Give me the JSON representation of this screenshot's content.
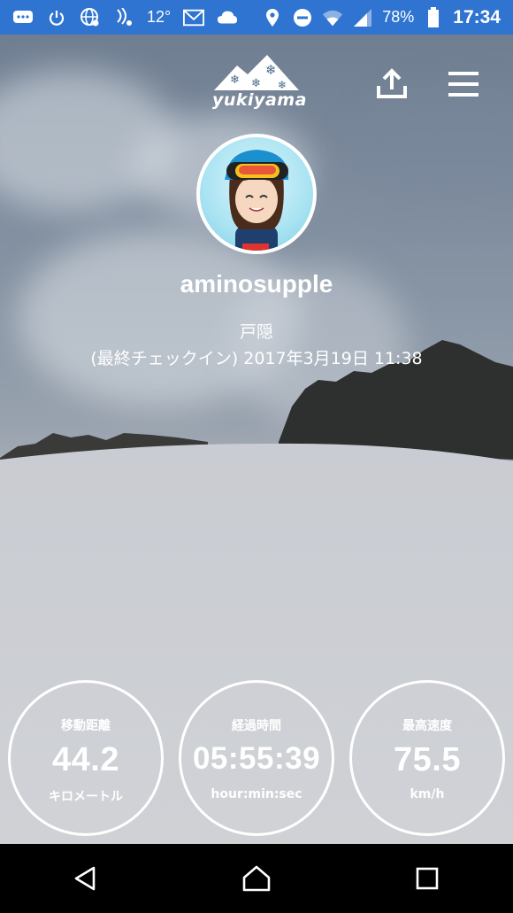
{
  "status_bar": {
    "temperature": "12°",
    "battery": "78%",
    "time": "17:34",
    "bg_color": "#2f74d0",
    "left_icons": [
      "chat-bubble-icon",
      "power-icon",
      "globe-icon",
      "nfc-icon",
      "temperature-text",
      "mail-icon",
      "cloud-icon"
    ],
    "right_icons": [
      "location-icon",
      "do-not-disturb-icon",
      "wifi-icon",
      "signal-icon",
      "battery-icon"
    ]
  },
  "header": {
    "logo_text": "yukiyama",
    "share_icon": "share-upload-icon",
    "menu_icon": "hamburger-menu-icon"
  },
  "profile": {
    "username": "aminosupple",
    "resort": "戸隠",
    "last_checkin": "(最終チェックイン) 2017年3月19日 11:38"
  },
  "stats": [
    {
      "label": "移動距離",
      "value": "44.2",
      "unit": "キロメートル"
    },
    {
      "label": "経過時間",
      "value": "05:55:39",
      "unit": "hour:min:sec"
    },
    {
      "label": "最高速度",
      "value": "75.5",
      "unit": "km/h"
    }
  ],
  "nav": {
    "back": "back-icon",
    "home": "home-icon",
    "recents": "recents-icon"
  }
}
